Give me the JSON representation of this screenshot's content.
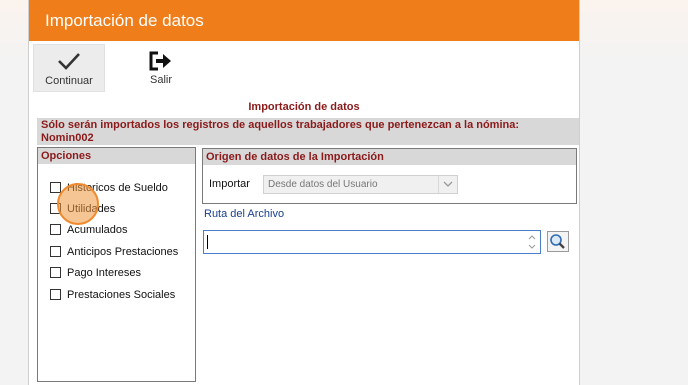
{
  "window": {
    "title": "Importación de datos"
  },
  "toolbar": {
    "continue_label": "Continuar",
    "exit_label": "Salir",
    "continue_icon": "check-icon",
    "exit_icon": "exit-arrow-icon"
  },
  "main": {
    "section_title": "Importación de datos",
    "notice_line1": "Sólo serán importados los registros de aquellos trabajadores que pertenezcan a la nómina:",
    "notice_line2": "Nomin002"
  },
  "options": {
    "header": "Opciones",
    "items": [
      {
        "label": "Historicos de Sueldo",
        "checked": false
      },
      {
        "label": "Utilidades",
        "checked": false
      },
      {
        "label": "Acumulados",
        "checked": false
      },
      {
        "label": "Anticipos Prestaciones",
        "checked": false
      },
      {
        "label": "Pago Intereses",
        "checked": false
      },
      {
        "label": "Prestaciones Sociales",
        "checked": false
      }
    ]
  },
  "origin": {
    "header": "Origen de datos de la Importación",
    "import_label": "Importar",
    "import_value": "Desde datos del Usuario"
  },
  "path": {
    "label": "Ruta del Archivo",
    "value": ""
  },
  "colors": {
    "title_bar": "#ef7d1a",
    "accent_text": "#8b1a1a",
    "group_header_bg": "#d8d8d8",
    "click_marker": "#f08a2e"
  }
}
